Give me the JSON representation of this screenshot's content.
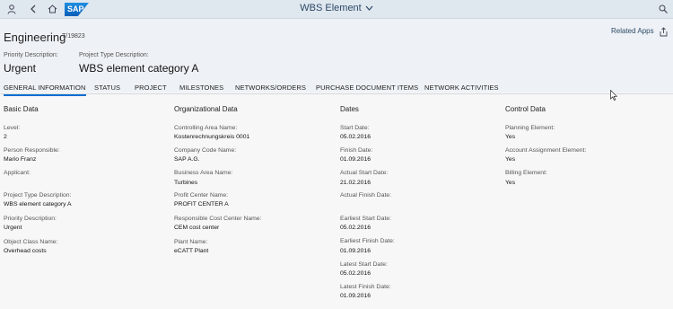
{
  "shell": {
    "logo_text": "SAP",
    "app_title": "WBS Element",
    "icons": [
      "user-icon",
      "back-icon",
      "home-icon",
      "search-icon"
    ]
  },
  "header": {
    "title": "Engineering",
    "object_id": "T/19823",
    "related_apps": "Related Apps",
    "attributes": [
      {
        "label": "Priority Description:",
        "value": "Urgent"
      },
      {
        "label": "Project Type Description:",
        "value": "WBS element category A"
      }
    ]
  },
  "tabs": [
    {
      "label": "GENERAL INFORMATION",
      "active": true
    },
    {
      "label": "STATUS"
    },
    {
      "label": "PROJECT"
    },
    {
      "label": "MILESTONES"
    },
    {
      "label": "NETWORKS/ORDERS"
    },
    {
      "label": "PURCHASE DOCUMENT ITEMS"
    },
    {
      "label": "NETWORK ACTIVITIES"
    }
  ],
  "sections": [
    {
      "title": "Basic Data",
      "fields": [
        {
          "label": "Level:",
          "value": "2"
        },
        {
          "label": "Person Responsible:",
          "value": "Mario Franz"
        },
        {
          "label": "Applicant:",
          "value": ""
        },
        {
          "label": "Project Type Description:",
          "value": "WBS element category A"
        },
        {
          "label": "Priority Description:",
          "value": "Urgent"
        },
        {
          "label": "Object Class Name:",
          "value": "Overhead costs"
        }
      ]
    },
    {
      "title": "Organizational Data",
      "fields": [
        {
          "label": "Controlling Area Name:",
          "value": "Kostenrechnungskreis 0001"
        },
        {
          "label": "Company Code Name:",
          "value": "SAP A.G."
        },
        {
          "label": "Business Area Name:",
          "value": "Turbines"
        },
        {
          "label": "Profit Center Name:",
          "value": "PROFIT CENTER A"
        },
        {
          "label": "Responsible Cost Center Name:",
          "value": "CEM cost center"
        },
        {
          "label": "Plant Name:",
          "value": "eCATT Plant"
        }
      ]
    },
    {
      "title": "Dates",
      "fields": [
        {
          "label": "Start Date:",
          "value": "05.02.2016"
        },
        {
          "label": "Finish Date:",
          "value": "01.09.2016"
        },
        {
          "label": "Actual Start Date:",
          "value": "21.02.2016"
        },
        {
          "label": "Actual Finish Date:",
          "value": ""
        },
        {
          "label": "Earliest Start Date:",
          "value": "05.02.2016"
        },
        {
          "label": "Earliest Finish Date:",
          "value": "01.09.2016"
        },
        {
          "label": "Latest Start Date:",
          "value": "05.02.2016"
        },
        {
          "label": "Latest Finish Date:",
          "value": "01.09.2016"
        }
      ]
    },
    {
      "title": "Control Data",
      "fields": [
        {
          "label": "Planning Element:",
          "value": "Yes"
        },
        {
          "label": "Account Assignment Element:",
          "value": "Yes"
        },
        {
          "label": "Billing Element:",
          "value": "Yes"
        }
      ]
    }
  ],
  "colors": {
    "accent": "#0a6ed1",
    "shell": "#dfe7ef",
    "header": "#eef2f6"
  }
}
